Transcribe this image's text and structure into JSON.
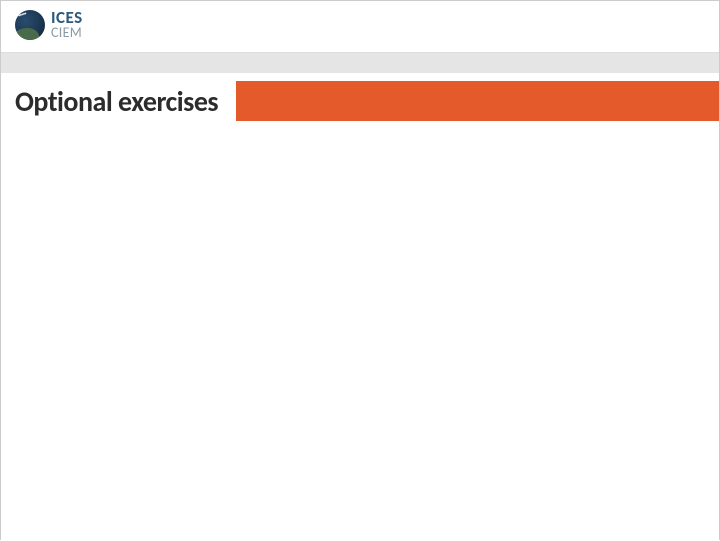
{
  "logo": {
    "line1": "ICES",
    "line2": "CIEM"
  },
  "title": "Optional exercises",
  "colors": {
    "accent_orange": "#e55a2b",
    "logo_blue": "#2b5a7d",
    "logo_gray": "#8a9aa5",
    "band_gray": "#e5e5e5"
  }
}
